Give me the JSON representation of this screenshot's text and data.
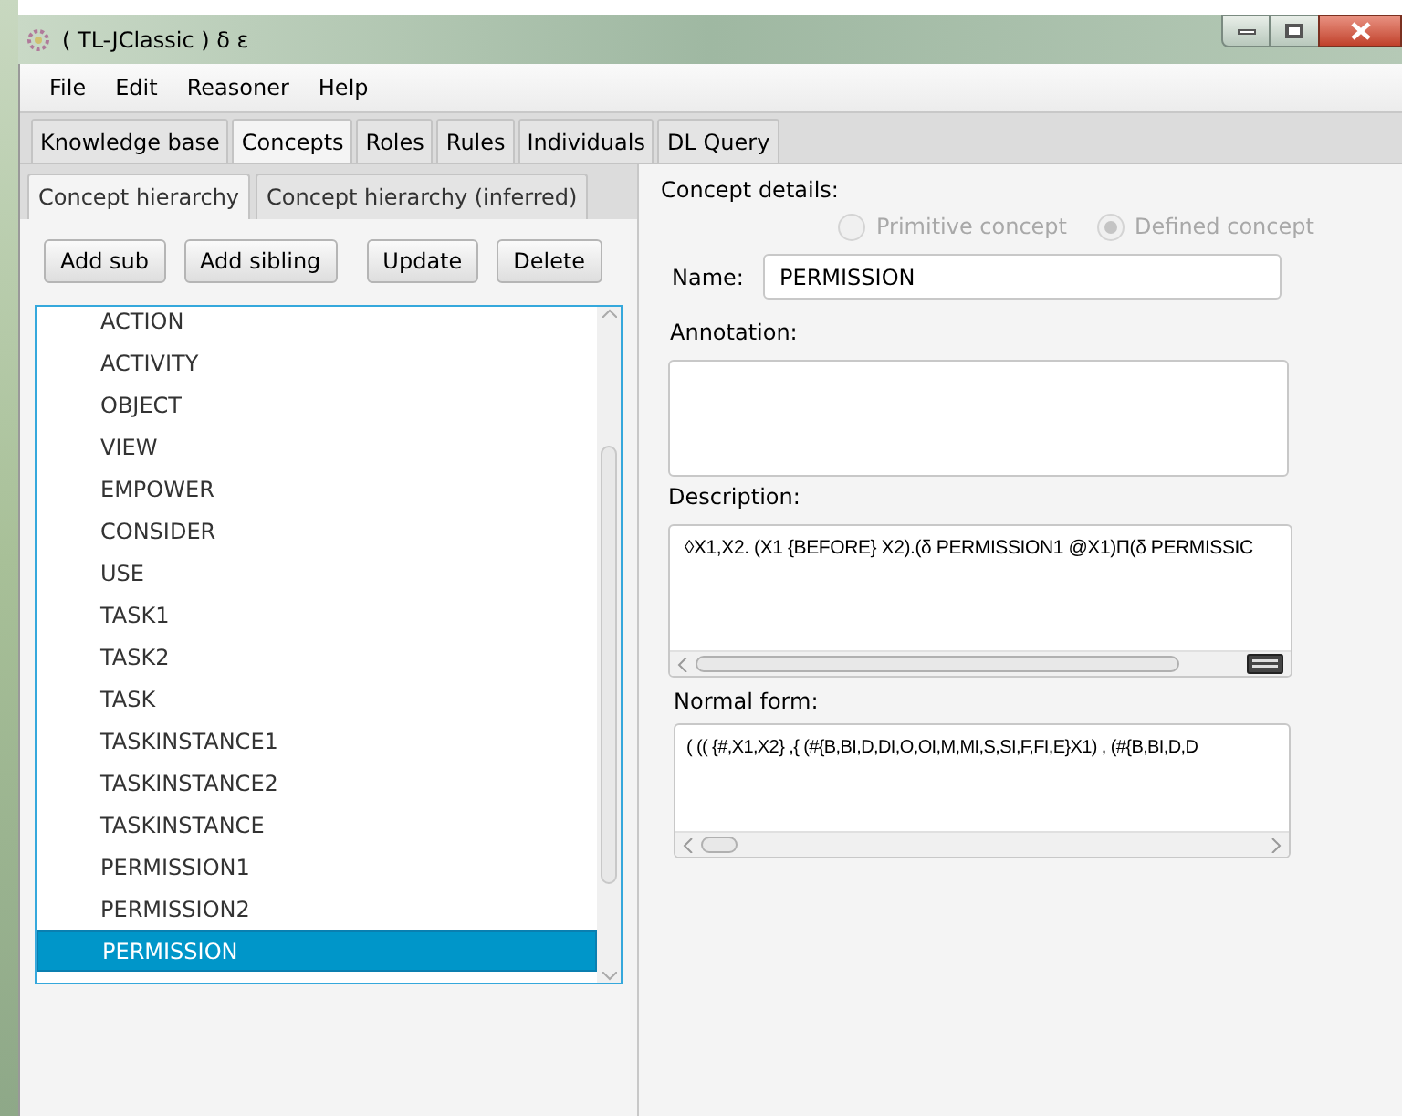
{
  "window": {
    "title": "( TL-JClassic ) δ ε"
  },
  "menu": [
    "File",
    "Edit",
    "Reasoner",
    "Help"
  ],
  "tabs": [
    {
      "label": "Knowledge base",
      "selected": false
    },
    {
      "label": "Concepts",
      "selected": true
    },
    {
      "label": "Roles",
      "selected": false
    },
    {
      "label": "Rules",
      "selected": false
    },
    {
      "label": "Individuals",
      "selected": false
    },
    {
      "label": "DL Query",
      "selected": false
    }
  ],
  "hierarchy_tabs": [
    {
      "label": "Concept hierarchy",
      "selected": true
    },
    {
      "label": "Concept hierarchy (inferred)",
      "selected": false
    }
  ],
  "toolbar": [
    "Add sub",
    "Add sibling",
    "Update",
    "Delete"
  ],
  "concepts": [
    {
      "label": "ACTION",
      "selected": false
    },
    {
      "label": "ACTIVITY",
      "selected": false
    },
    {
      "label": "OBJECT",
      "selected": false
    },
    {
      "label": "VIEW",
      "selected": false
    },
    {
      "label": "EMPOWER",
      "selected": false
    },
    {
      "label": "CONSIDER",
      "selected": false
    },
    {
      "label": "USE",
      "selected": false
    },
    {
      "label": "TASK1",
      "selected": false
    },
    {
      "label": "TASK2",
      "selected": false
    },
    {
      "label": "TASK",
      "selected": false
    },
    {
      "label": "TASKINSTANCE1",
      "selected": false
    },
    {
      "label": "TASKINSTANCE2",
      "selected": false
    },
    {
      "label": "TASKINSTANCE",
      "selected": false
    },
    {
      "label": "PERMISSION1",
      "selected": false
    },
    {
      "label": "PERMISSION2",
      "selected": false
    },
    {
      "label": "PERMISSION",
      "selected": true
    }
  ],
  "details": {
    "heading": "Concept details:",
    "concept_types": [
      {
        "label": "Primitive concept",
        "selected": false
      },
      {
        "label": "Defined concept",
        "selected": true
      }
    ],
    "name_label": "Name:",
    "name": "PERMISSION",
    "annotation_label": "Annotation:",
    "description_label": "Description:",
    "description": "◊X1,X2. (X1 {BEFORE} X2).(δ PERMISSION1 @X1)Π(δ PERMISSIC",
    "normal_form_label": "Normal form:",
    "normal_form": "( (( {#,X1,X2} ,{ (#{B,BI,D,DI,O,OI,M,MI,S,SI,F,FI,E}X1) , (#{B,BI,D,D"
  }
}
